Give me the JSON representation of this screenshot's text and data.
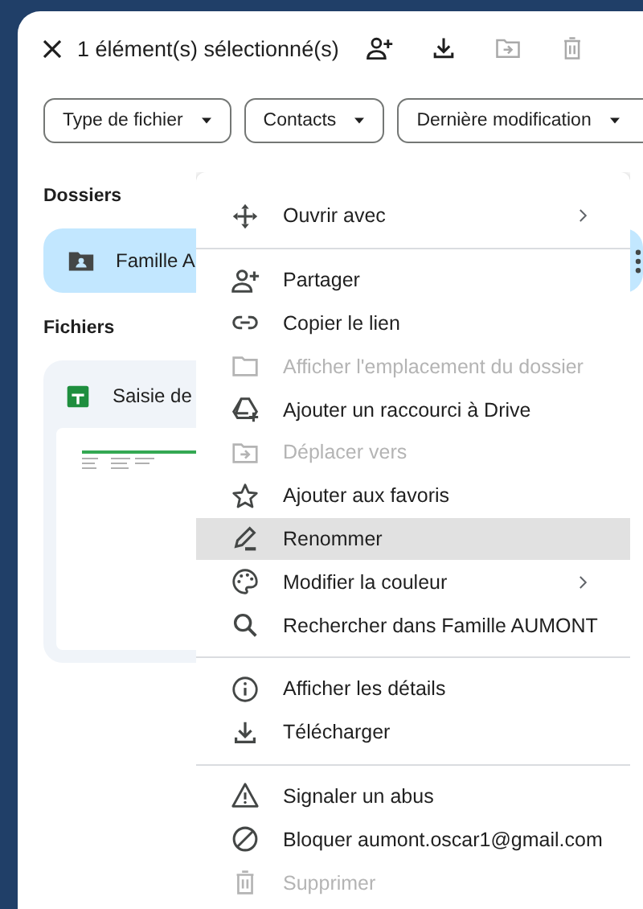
{
  "toolbar": {
    "title": "1 élément(s) sélectionné(s)",
    "actions": [
      {
        "disabled": false
      },
      {
        "disabled": false
      },
      {
        "disabled": true
      },
      {
        "disabled": true
      }
    ]
  },
  "filters": [
    {
      "label": "Type de fichier"
    },
    {
      "label": "Contacts"
    },
    {
      "label": "Dernière modification"
    }
  ],
  "folders": {
    "heading": "Dossiers",
    "items": [
      {
        "name": "Famille A",
        "selected": true
      }
    ]
  },
  "files": {
    "heading": "Fichiers",
    "items": [
      {
        "name": "Saisie de"
      }
    ]
  },
  "context_menu": {
    "groups": [
      [
        {
          "label": "Ouvrir avec",
          "disabled": false,
          "highlighted": false,
          "submenu": true
        }
      ],
      [
        {
          "label": "Partager",
          "disabled": false,
          "highlighted": false,
          "submenu": false
        },
        {
          "label": "Copier le lien",
          "disabled": false,
          "highlighted": false,
          "submenu": false
        },
        {
          "label": "Afficher l'emplacement du dossier",
          "disabled": true,
          "highlighted": false,
          "submenu": false
        },
        {
          "label": "Ajouter un raccourci à Drive",
          "disabled": false,
          "highlighted": false,
          "submenu": false
        },
        {
          "label": "Déplacer vers",
          "disabled": true,
          "highlighted": false,
          "submenu": false
        },
        {
          "label": "Ajouter aux favoris",
          "disabled": false,
          "highlighted": false,
          "submenu": false
        },
        {
          "label": "Renommer",
          "disabled": false,
          "highlighted": true,
          "submenu": false
        },
        {
          "label": "Modifier la couleur",
          "disabled": false,
          "highlighted": false,
          "submenu": true
        },
        {
          "label": "Rechercher dans Famille AUMONT",
          "disabled": false,
          "highlighted": false,
          "submenu": false
        }
      ],
      [
        {
          "label": "Afficher les détails",
          "disabled": false,
          "highlighted": false,
          "submenu": false
        },
        {
          "label": "Télécharger",
          "disabled": false,
          "highlighted": false,
          "submenu": false
        }
      ],
      [
        {
          "label": "Signaler un abus",
          "disabled": false,
          "highlighted": false,
          "submenu": false
        },
        {
          "label": "Bloquer aumont.oscar1@gmail.com",
          "disabled": false,
          "highlighted": false,
          "submenu": false
        },
        {
          "label": "Supprimer",
          "disabled": true,
          "highlighted": false,
          "submenu": false
        }
      ]
    ]
  }
}
